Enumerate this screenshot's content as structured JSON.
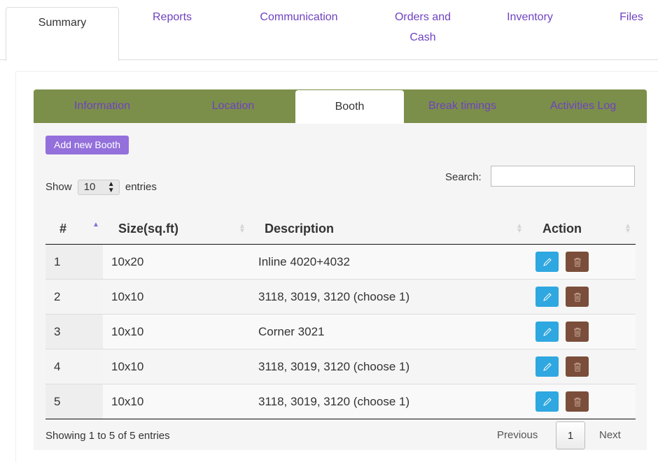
{
  "top_tabs": [
    {
      "label": "Summary"
    },
    {
      "label": "Reports"
    },
    {
      "label": "Communication"
    },
    {
      "label": "Orders and Cash"
    },
    {
      "label": "Inventory"
    },
    {
      "label": "Files"
    }
  ],
  "sub_tabs": [
    {
      "label": "Information"
    },
    {
      "label": "Location"
    },
    {
      "label": "Booth"
    },
    {
      "label": "Break timings"
    },
    {
      "label": "Activities Log"
    }
  ],
  "add_button_label": "Add new Booth",
  "length": {
    "show": "Show",
    "value": "10",
    "entries": "entries"
  },
  "search": {
    "label": "Search:",
    "value": ""
  },
  "table": {
    "headers": [
      "#",
      "Size(sq.ft)",
      "Description",
      "Action"
    ],
    "rows": [
      {
        "num": "1",
        "size": "10x20",
        "desc": "Inline 4020+4032"
      },
      {
        "num": "2",
        "size": "10x10",
        "desc": "3118, 3019, 3120 (choose 1)"
      },
      {
        "num": "3",
        "size": "10x10",
        "desc": "Corner 3021"
      },
      {
        "num": "4",
        "size": "10x10",
        "desc": "3118, 3019, 3120 (choose 1)"
      },
      {
        "num": "5",
        "size": "10x10",
        "desc": "3118, 3019, 3120 (choose 1)"
      }
    ]
  },
  "info": "Showing 1 to 5 of 5 entries",
  "pagination": {
    "previous": "Previous",
    "page": "1",
    "next": "Next"
  },
  "colors": {
    "accent": "#6f42c1",
    "tab_bar": "#7b8f4a",
    "edit": "#2fa7e0",
    "delete": "#7a4e3a",
    "add_button": "#9370db"
  }
}
